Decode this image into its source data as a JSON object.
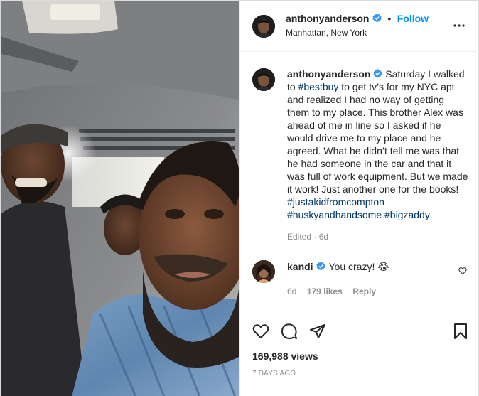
{
  "header": {
    "username": "anthonyanderson",
    "separator": "•",
    "follow_label": "Follow",
    "location": "Manhattan, New York",
    "more_icon": "more-horizontal-icon"
  },
  "caption": {
    "username": "anthonyanderson",
    "text_1": "Saturday I walked to ",
    "tag_1": "#bestbuy",
    "text_2": " to get tv’s for my NYC apt and realized I had no way of getting them to my place. This brother Alex was ahead of me in line so I asked if he would drive me to my place and he agreed. What he didn’t tell me was that he had someone in the car and that it was full of work equipment. But we made it work! Just another one for the books! ",
    "tag_2": "#justakidfromcompton",
    "tag_3": "#huskyandhandsome",
    "tag_4": "#bigzaddy",
    "edited": "Edited · 6d"
  },
  "comment": {
    "username": "kandi",
    "text": "You crazy! 😂",
    "age": "6d",
    "likes": "179 likes",
    "reply": "Reply"
  },
  "footer": {
    "views": "169,988 views",
    "date": "7 DAYS AGO"
  },
  "colors": {
    "link": "#00376b",
    "follow": "#0095f6",
    "verified": "#3897f0",
    "muted": "#8e8e8e"
  }
}
